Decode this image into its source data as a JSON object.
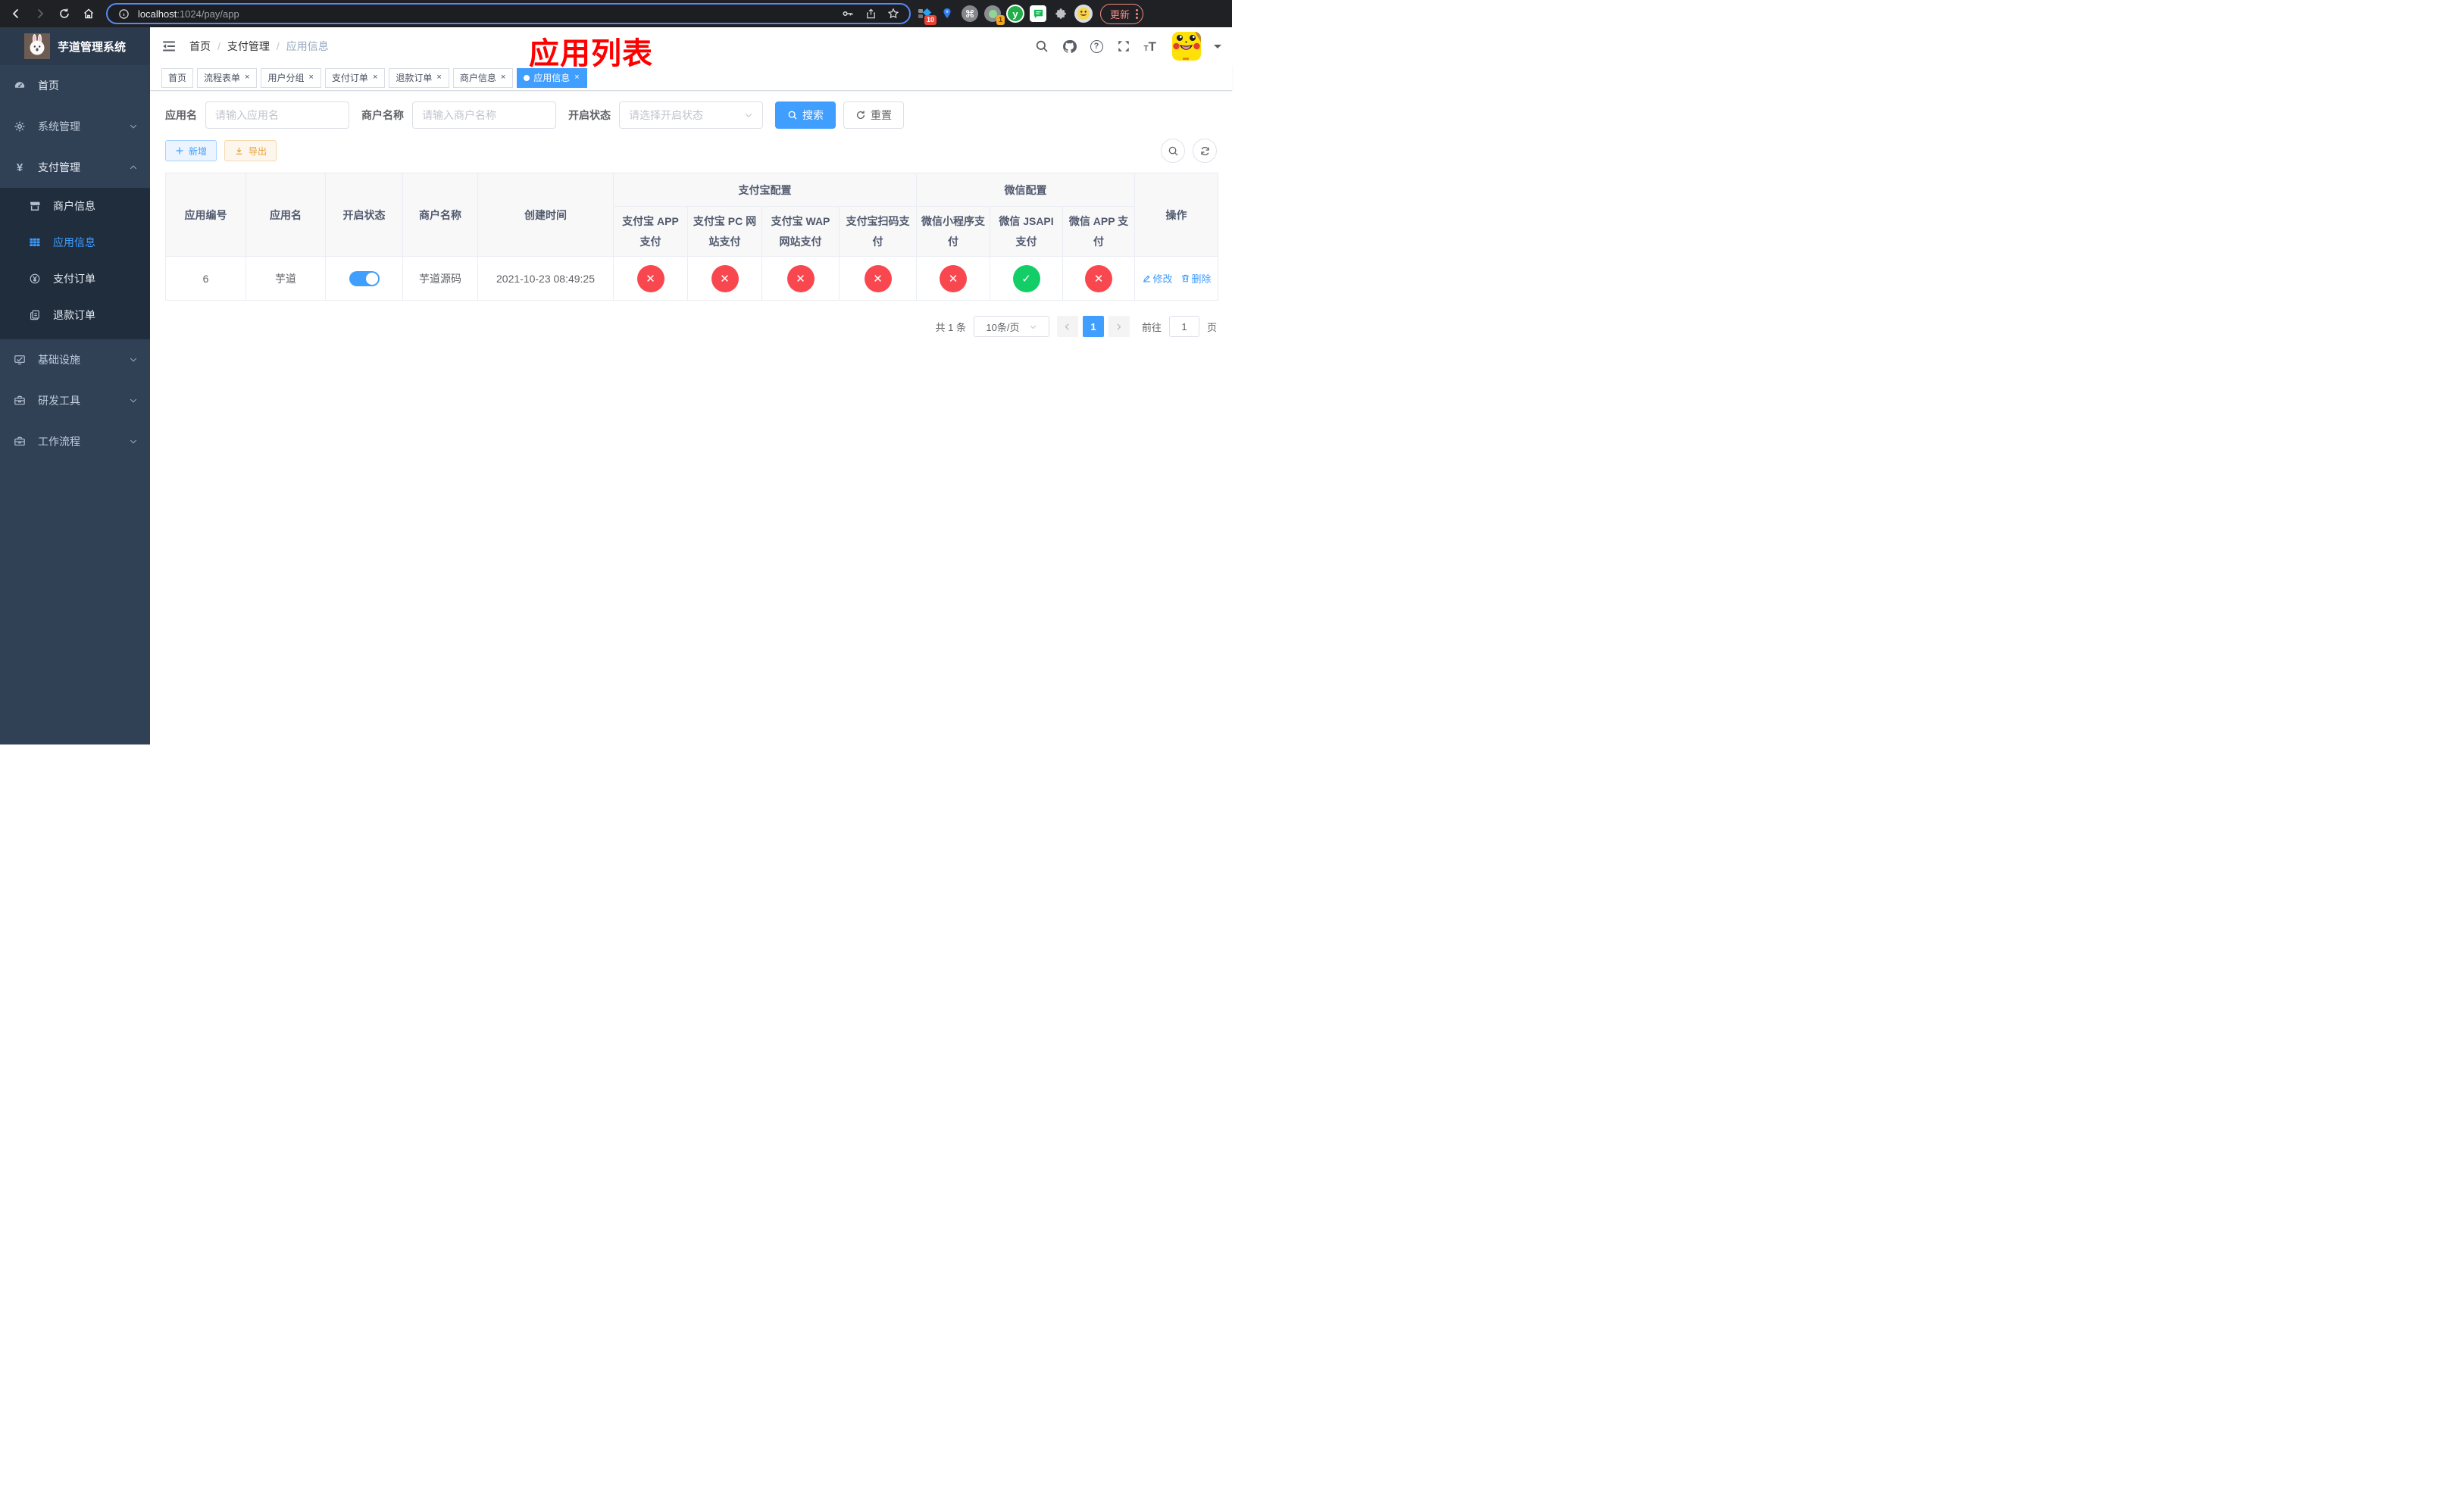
{
  "browser": {
    "url_host": "localhost",
    "url_path": ":1024/pay/app",
    "update_button": "更新",
    "extension_badge_1": "10",
    "extension_badge_2": "1"
  },
  "sidebar": {
    "title": "芋道管理系统",
    "items": [
      {
        "label": "首页",
        "icon": "dashboard-icon",
        "kind": "link"
      },
      {
        "label": "系统管理",
        "icon": "gear-icon",
        "kind": "group",
        "state": "collapsed"
      },
      {
        "label": "支付管理",
        "icon": "yen-icon",
        "kind": "group",
        "state": "expanded",
        "children": [
          {
            "label": "商户信息",
            "icon": "shop-icon",
            "active": false
          },
          {
            "label": "应用信息",
            "icon": "grid-icon",
            "active": true
          },
          {
            "label": "支付订单",
            "icon": "coin-icon",
            "active": false
          },
          {
            "label": "退款订单",
            "icon": "copy-icon",
            "active": false
          }
        ]
      },
      {
        "label": "基础设施",
        "icon": "monitor-icon",
        "kind": "group",
        "state": "collapsed"
      },
      {
        "label": "研发工具",
        "icon": "toolbox-icon",
        "kind": "group",
        "state": "collapsed"
      },
      {
        "label": "工作流程",
        "icon": "briefcase-icon",
        "kind": "group",
        "state": "collapsed"
      }
    ]
  },
  "header": {
    "breadcrumb": [
      "首页",
      "支付管理",
      "应用信息"
    ],
    "overlay_title": "应用列表"
  },
  "tabs": [
    {
      "label": "首页",
      "closable": false,
      "active": false
    },
    {
      "label": "流程表单",
      "closable": true,
      "active": false
    },
    {
      "label": "用户分组",
      "closable": true,
      "active": false
    },
    {
      "label": "支付订单",
      "closable": true,
      "active": false
    },
    {
      "label": "退款订单",
      "closable": true,
      "active": false
    },
    {
      "label": "商户信息",
      "closable": true,
      "active": false
    },
    {
      "label": "应用信息",
      "closable": true,
      "active": true
    }
  ],
  "filters": {
    "app_name_label": "应用名",
    "app_name_placeholder": "请输入应用名",
    "merchant_label": "商户名称",
    "merchant_placeholder": "请输入商户名称",
    "status_label": "开启状态",
    "status_placeholder": "请选择开启状态",
    "search_button": "搜索",
    "reset_button": "重置"
  },
  "toolbar": {
    "add_button": "新增",
    "export_button": "导出"
  },
  "table": {
    "group_headers": [
      {
        "label": "支付宝配置",
        "span": 4
      },
      {
        "label": "微信配置",
        "span": 3
      }
    ],
    "columns": [
      "应用编号",
      "应用名",
      "开启状态",
      "商户名称",
      "创建时间",
      "支付宝 APP 支付",
      "支付宝 PC 网站支付",
      "支付宝 WAP 网站支付",
      "支付宝扫码支付",
      "微信小程序支付",
      "微信 JSAPI 支付",
      "微信 APP 支付",
      "操作"
    ],
    "rows": [
      {
        "id": "6",
        "name": "芋道",
        "enabled": true,
        "merchant": "芋道源码",
        "created": "2021-10-23 08:49:25",
        "statuses": [
          "no",
          "no",
          "no",
          "no",
          "no",
          "yes",
          "no"
        ],
        "actions": [
          "修改",
          "删除"
        ]
      }
    ]
  },
  "pagination": {
    "total": "共 1 条",
    "page_size": "10条/页",
    "current_page": "1",
    "goto_label": "前往",
    "goto_value": "1",
    "goto_suffix": "页"
  },
  "colors": {
    "accent": "#409eff",
    "success": "#13ce66",
    "danger": "#f9474f",
    "title_red": "#ff0000",
    "export_orange": "#e6a23c"
  }
}
